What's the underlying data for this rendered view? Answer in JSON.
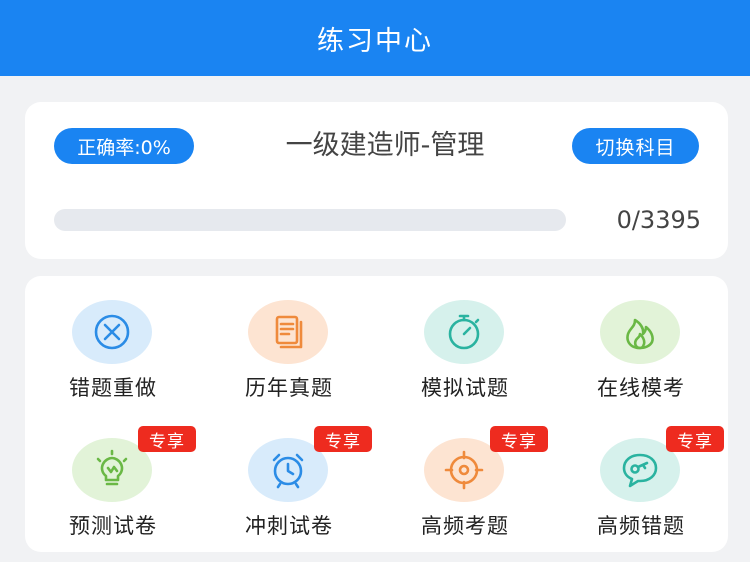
{
  "header": {
    "title": "练习中心"
  },
  "summary": {
    "accuracy_label": "正确率:0%",
    "subject": "一级建造师-管理",
    "switch_label": "切换科目",
    "progress_fraction": 0,
    "progress_text": "0/3395"
  },
  "grid": {
    "badge_text": "专享",
    "items": [
      {
        "label": "错题重做",
        "icon": "x-circle-icon",
        "bg": "#d8ebfb",
        "color": "#2b8ce6",
        "badge": false
      },
      {
        "label": "历年真题",
        "icon": "document-icon",
        "bg": "#fde4d2",
        "color": "#ef8a3c",
        "badge": false
      },
      {
        "label": "模拟试题",
        "icon": "stopwatch-icon",
        "bg": "#d6f1ec",
        "color": "#2ab3a0",
        "badge": false
      },
      {
        "label": "在线模考",
        "icon": "flame-icon",
        "bg": "#e2f3d8",
        "color": "#6ab845",
        "badge": true
      },
      {
        "label": "预测试卷",
        "icon": "lightbulb-icon",
        "bg": "#e2f3d8",
        "color": "#6ab845",
        "badge": true
      },
      {
        "label": "冲刺试卷",
        "icon": "alarm-clock-icon",
        "bg": "#d8ebfb",
        "color": "#2b8ce6",
        "badge": true
      },
      {
        "label": "高频考题",
        "icon": "target-icon",
        "bg": "#fde4d2",
        "color": "#ef8a3c",
        "badge": true
      },
      {
        "label": "高频错题",
        "icon": "chat-key-icon",
        "bg": "#d6f1ec",
        "color": "#2ab3a0",
        "badge": true
      }
    ]
  }
}
